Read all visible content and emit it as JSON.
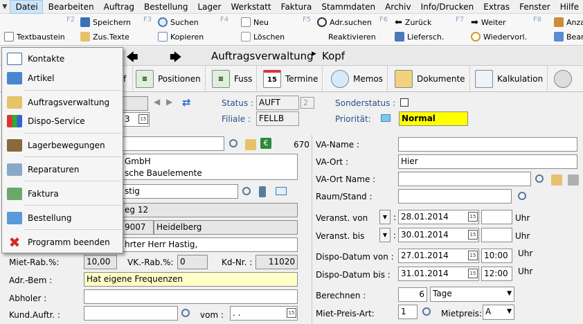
{
  "menubar": {
    "items": [
      "Datei",
      "Bearbeiten",
      "Auftrag",
      "Bestellung",
      "Lager",
      "Werkstatt",
      "Faktura",
      "Stammdaten",
      "Archiv",
      "Info/Drucken",
      "Extras",
      "Fenster",
      "Hilfe"
    ]
  },
  "toolbar": {
    "fkeys": [
      "F2",
      "F3",
      "F4",
      "F5",
      "F6",
      "F7",
      "F8"
    ],
    "row1": [
      "Speichern",
      "Suchen",
      "Neu",
      "Adr.suchen",
      "Zurück",
      "Weiter",
      "Anza"
    ],
    "row2": [
      "Textbaustein",
      "Zus.Texte",
      "Kopieren",
      "Löschen",
      "Reaktivieren",
      "Liefersch.",
      "Wiedervorl.",
      "Bearb"
    ]
  },
  "nav": {
    "title": "Auftragsverwaltung",
    "crumb": "Kopf"
  },
  "tabs": {
    "kopf_partial": "f",
    "positionen": "Positionen",
    "fuss": "Fuss",
    "termine": "Termine",
    "termine_day": "15",
    "memos": "Memos",
    "dokumente": "Dokumente",
    "kalkulation": "Kalkulation"
  },
  "dropdown": {
    "items": [
      {
        "label": "Kontakte"
      },
      {
        "label": "Artikel"
      },
      {
        "label": "Auftragsverwaltung"
      },
      {
        "label": "Dispo-Service"
      },
      {
        "label": "Lagerbewegungen"
      },
      {
        "label": "Reparaturen"
      },
      {
        "label": "Faktura"
      },
      {
        "label": "Bestellung"
      },
      {
        "label": "Programm beenden"
      }
    ]
  },
  "header": {
    "status_label": "Status :",
    "status_value": "AUFT",
    "status_num": "2",
    "filiale_label": "Filiale :",
    "filiale_value": "FELLB",
    "sonderstatus_label": "Sonderstatus :",
    "prioritaet_label": "Priorität:",
    "prioritaet_value": "Normal",
    "date_partial": "3",
    "cal_day": "15"
  },
  "left": {
    "kunde_num": "670",
    "name_line1": "GmbH",
    "name_line2": "sche Bauelemente",
    "contact": "stig",
    "street": "eg 12",
    "plz": "9007",
    "city": "Heidelberg",
    "anrede": "hrter Herr Hastig,",
    "miet_rab_label": "Miet-Rab.%:",
    "miet_rab_value": "10,00",
    "vk_rab_label": "VK.-Rab.%:",
    "vk_rab_value": "0",
    "kd_nr_label": "Kd-Nr. :",
    "kd_nr_value": "11020",
    "adr_bem_label": "Adr.-Bem :",
    "adr_bem_value": "Hat eigene Frequenzen",
    "abholer_label": "Abholer :",
    "kund_auftr_label": "Kund.Auftr. :",
    "vom_label": "vom :",
    "vom_value": ". ."
  },
  "right": {
    "va_name_label": "VA-Name :",
    "va_ort_label": "VA-Ort :",
    "va_ort_value": "Hier",
    "va_ort_name_label": "VA-Ort Name :",
    "raum_label": "Raum/Stand :",
    "von_label": "Veranst. von",
    "von_value": "28.01.2014",
    "bis_label": "Veranst. bis",
    "bis_value": "30.01.2014",
    "uhr": "Uhr",
    "dispo_von_label": "Dispo-Datum von :",
    "dispo_von_value": "27.01.2014",
    "dispo_von_time": "10:00",
    "dispo_bis_label": "Dispo-Datum bis :",
    "dispo_bis_value": "31.01.2014",
    "dispo_bis_time": "12:00",
    "berechnen_label": "Berechnen :",
    "berechnen_value": "6",
    "berechnen_unit": "Tage",
    "mietpreisart_label": "Miet-Preis-Art:",
    "mietpreisart_value": "1",
    "mietpreis_label": "Mietpreis:",
    "mietpreis_value": "A"
  }
}
